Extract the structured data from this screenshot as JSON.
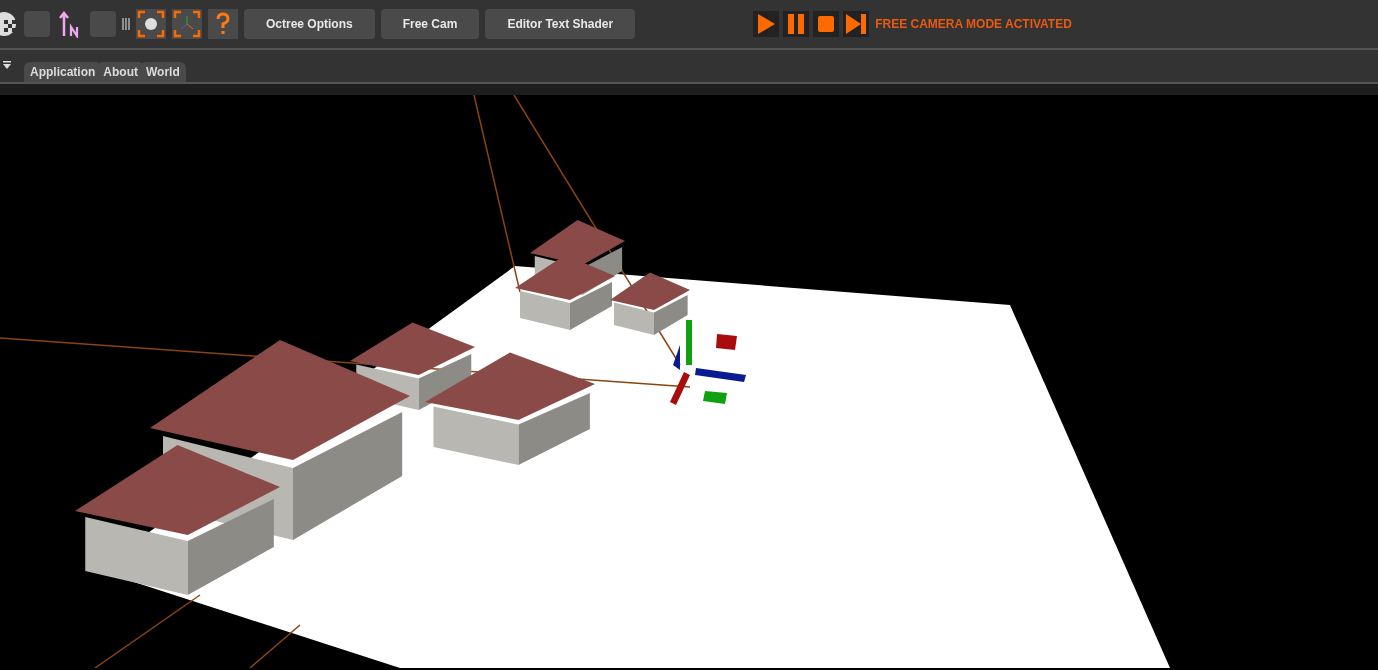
{
  "toolbar": {
    "buttons": [
      {
        "label": "Octree Options"
      },
      {
        "label": "Free Cam"
      },
      {
        "label": "Editor Text Shader"
      }
    ],
    "status": "FREE CAMERA MODE ACTIVATED"
  },
  "tabs": [
    {
      "label": "Application",
      "selected": false
    },
    {
      "label": "About",
      "selected": false
    },
    {
      "label": "World",
      "selected": false
    }
  ]
}
